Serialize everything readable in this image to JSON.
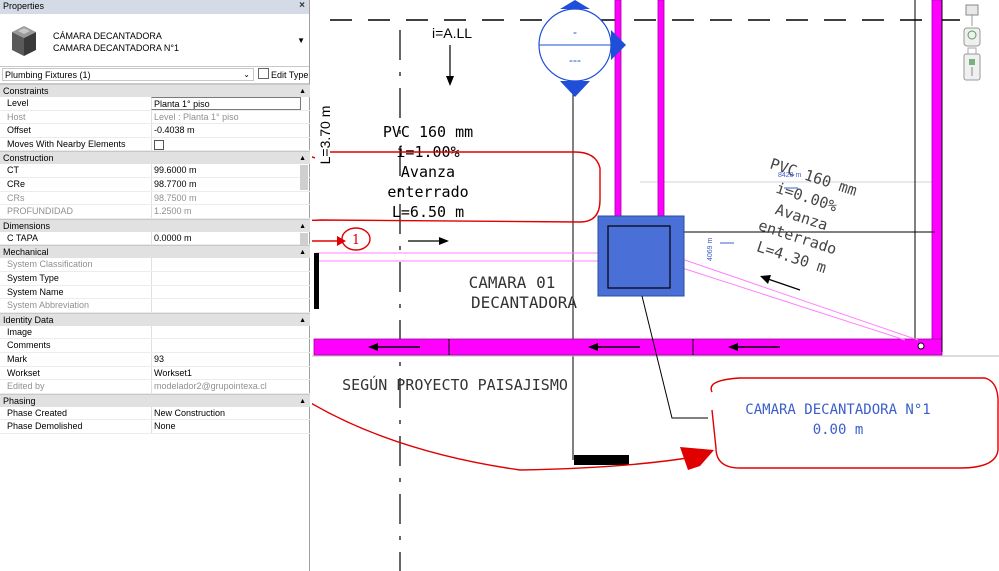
{
  "panel": {
    "title": "Properties",
    "close": "×",
    "type_line1": "CÁMARA DECANTADORA",
    "type_line2": "CAMARA DECANTADORA N°1",
    "selector": "Plumbing Fixtures (1)",
    "edit_type": "Edit Type"
  },
  "groups": {
    "constraints": "Constraints",
    "construction": "Construction",
    "dimensions": "Dimensions",
    "mechanical": "Mechanical",
    "identity": "Identity Data",
    "phasing": "Phasing"
  },
  "rows": {
    "level": {
      "k": "Level",
      "v": "Planta 1° piso"
    },
    "host": {
      "k": "Host",
      "v": "Level : Planta 1° piso"
    },
    "offset": {
      "k": "Offset",
      "v": "-0.4038 m"
    },
    "moves": {
      "k": "Moves With Nearby Elements",
      "v": ""
    },
    "ct": {
      "k": "CT",
      "v": "99.6000 m"
    },
    "cre": {
      "k": "CRe",
      "v": "98.7700 m"
    },
    "crs": {
      "k": "CRs",
      "v": "98.7500 m"
    },
    "prof": {
      "k": "PROFUNDIDAD",
      "v": "1.2500 m"
    },
    "ctapa": {
      "k": "C TAPA",
      "v": "0.0000 m"
    },
    "sysclass": {
      "k": "System Classification",
      "v": ""
    },
    "systype": {
      "k": "System Type",
      "v": ""
    },
    "sysname": {
      "k": "System Name",
      "v": ""
    },
    "sysabbr": {
      "k": "System Abbreviation",
      "v": ""
    },
    "image": {
      "k": "Image",
      "v": ""
    },
    "comments": {
      "k": "Comments",
      "v": ""
    },
    "mark": {
      "k": "Mark",
      "v": "93"
    },
    "workset": {
      "k": "Workset",
      "v": "Workset1"
    },
    "edited": {
      "k": "Edited by",
      "v": "modelador2@grupointexa.cl"
    },
    "phasecreated": {
      "k": "Phase Created",
      "v": "New Construction"
    },
    "phasedemolished": {
      "k": "Phase Demolished",
      "v": "None"
    }
  },
  "drawing": {
    "ial": "i=A.LL",
    "dim_vertical": "L=3.70 m",
    "pipe1": [
      "PVC 160 mm",
      "i=1.00%",
      "Avanza",
      "enterrado",
      "L=6.50 m"
    ],
    "pipe2": [
      "PVC 160 mm",
      "i=0.00%",
      "Avanza",
      "enterrado",
      "L=4.30 m"
    ],
    "camara": [
      "CAMARA 01",
      "DECANTADORA"
    ],
    "proyecto": "SEGÚN PROYECTO PAISAJISMO",
    "tag": [
      "CAMARA DECANTADORA N°1",
      "0.00 m"
    ],
    "dim1": "8428 m",
    "dim2": "4069 m",
    "annot_num": "1",
    "marker_top": "-",
    "marker_bottom": "---",
    "colors": {
      "pipe": "#ff00ff",
      "box": "#4a6fd6",
      "annot": "#e00000",
      "tag": "#3b5fc8",
      "marker": "#1f4fd8"
    }
  }
}
